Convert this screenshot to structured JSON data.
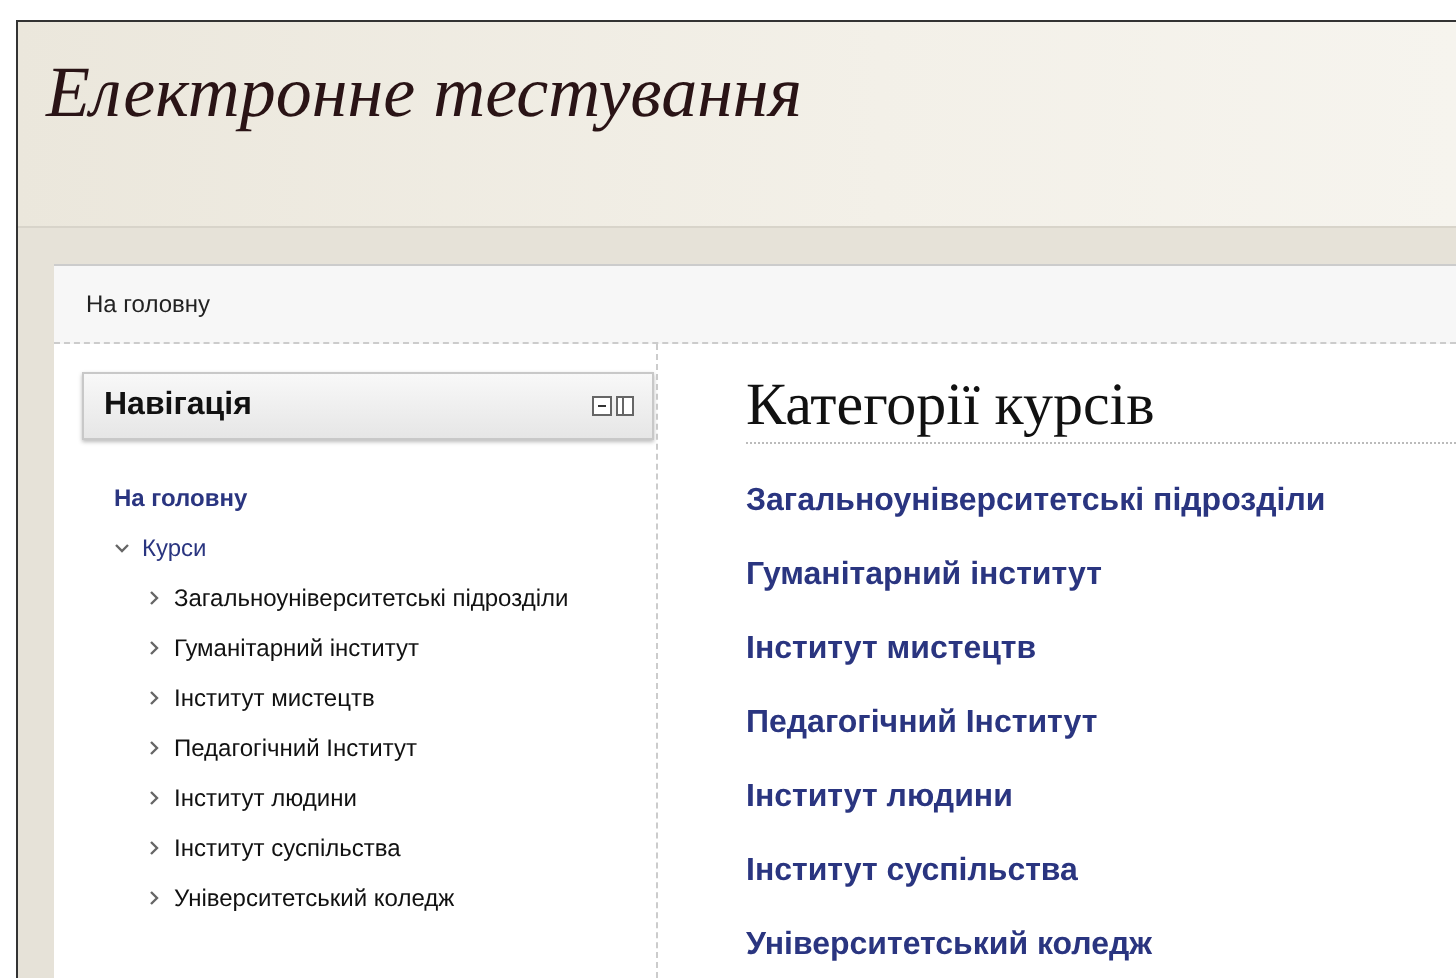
{
  "site_title": "Електронне тестування",
  "breadcrumb": "На головну",
  "navigation": {
    "title": "Навігація",
    "items": [
      {
        "label": "На головну",
        "kind": "link"
      },
      {
        "label": "Курси",
        "kind": "branch",
        "expanded": true,
        "children": [
          {
            "label": "Загальноуніверситетські підрозділи",
            "kind": "branch",
            "expanded": false
          },
          {
            "label": "Гуманітарний інститут",
            "kind": "branch",
            "expanded": false
          },
          {
            "label": "Інститут мистецтв",
            "kind": "branch",
            "expanded": false
          },
          {
            "label": "Педагогічний Інститут",
            "kind": "branch",
            "expanded": false
          },
          {
            "label": "Інститут людини",
            "kind": "branch",
            "expanded": false
          },
          {
            "label": "Інститут суспільства",
            "kind": "branch",
            "expanded": false
          },
          {
            "label": "Університетський коледж",
            "kind": "branch",
            "expanded": false
          }
        ]
      }
    ]
  },
  "main": {
    "heading": "Категорії курсів",
    "categories": [
      "Загальноуніверситетські підрозділи",
      "Гуманітарний інститут",
      "Інститут мистецтв",
      "Педагогічний Інститут",
      "Інститут людини",
      "Інститут суспільства",
      "Університетський коледж"
    ]
  }
}
